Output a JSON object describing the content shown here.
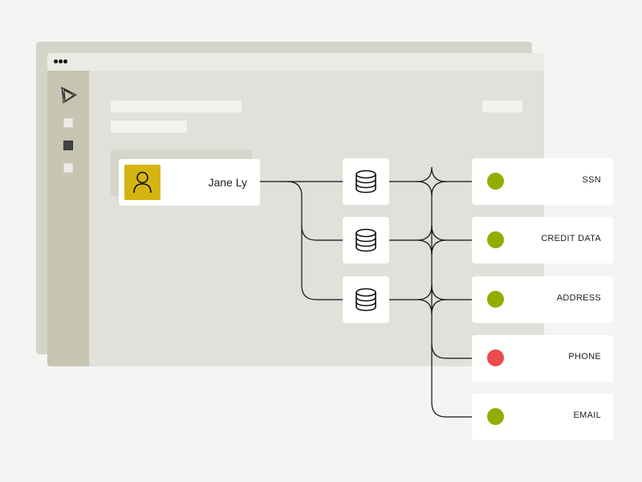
{
  "window": {
    "controls": [
      "dot",
      "dot",
      "dot"
    ],
    "logo_icon": "prism-logo-icon",
    "sidebar_items": [
      {
        "name": "nav-item-1",
        "active": false
      },
      {
        "name": "nav-item-2",
        "active": true
      },
      {
        "name": "nav-item-3",
        "active": false
      }
    ]
  },
  "person": {
    "name": "Jane Ly",
    "icon": "user-icon",
    "avatar_color": "#d4b411"
  },
  "databases": [
    {
      "icon": "database-icon"
    },
    {
      "icon": "database-icon"
    },
    {
      "icon": "database-icon"
    }
  ],
  "attributes": [
    {
      "label": "SSN",
      "status": "ok",
      "color": "#8fae00"
    },
    {
      "label": "CREDIT DATA",
      "status": "ok",
      "color": "#8fae00"
    },
    {
      "label": "ADDRESS",
      "status": "ok",
      "color": "#8fae00"
    },
    {
      "label": "PHONE",
      "status": "alert",
      "color": "#ec4b4b"
    },
    {
      "label": "EMAIL",
      "status": "ok",
      "color": "#8fae00"
    }
  ],
  "colors": {
    "ok": "#8fae00",
    "alert": "#ec4b4b",
    "accent": "#d4b411"
  }
}
